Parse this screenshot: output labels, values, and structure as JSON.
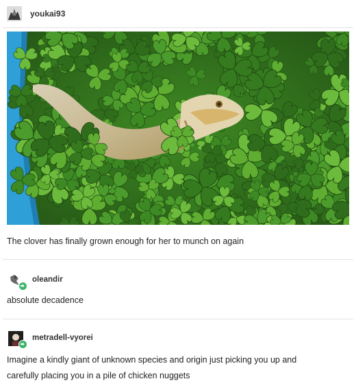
{
  "original_post": {
    "username": "youkai93",
    "image_alt": "bearded dragon lizard sitting in clover",
    "caption": "The clover has finally grown enough for her to munch on again"
  },
  "reblogs": [
    {
      "username": "oleandir",
      "text": "absolute decadence"
    },
    {
      "username": "metradell-vyorei",
      "text_line1": "Imagine a kindly giant of unknown species and origin just picking you up and",
      "text_line2": "carefully placing you in a pile of chicken nuggets"
    }
  ],
  "colors": {
    "reblog_badge": "#3ab66b",
    "clover_dark": "#2f6d1c",
    "clover_light": "#5fae32",
    "pool_blue": "#2f9fd8"
  }
}
